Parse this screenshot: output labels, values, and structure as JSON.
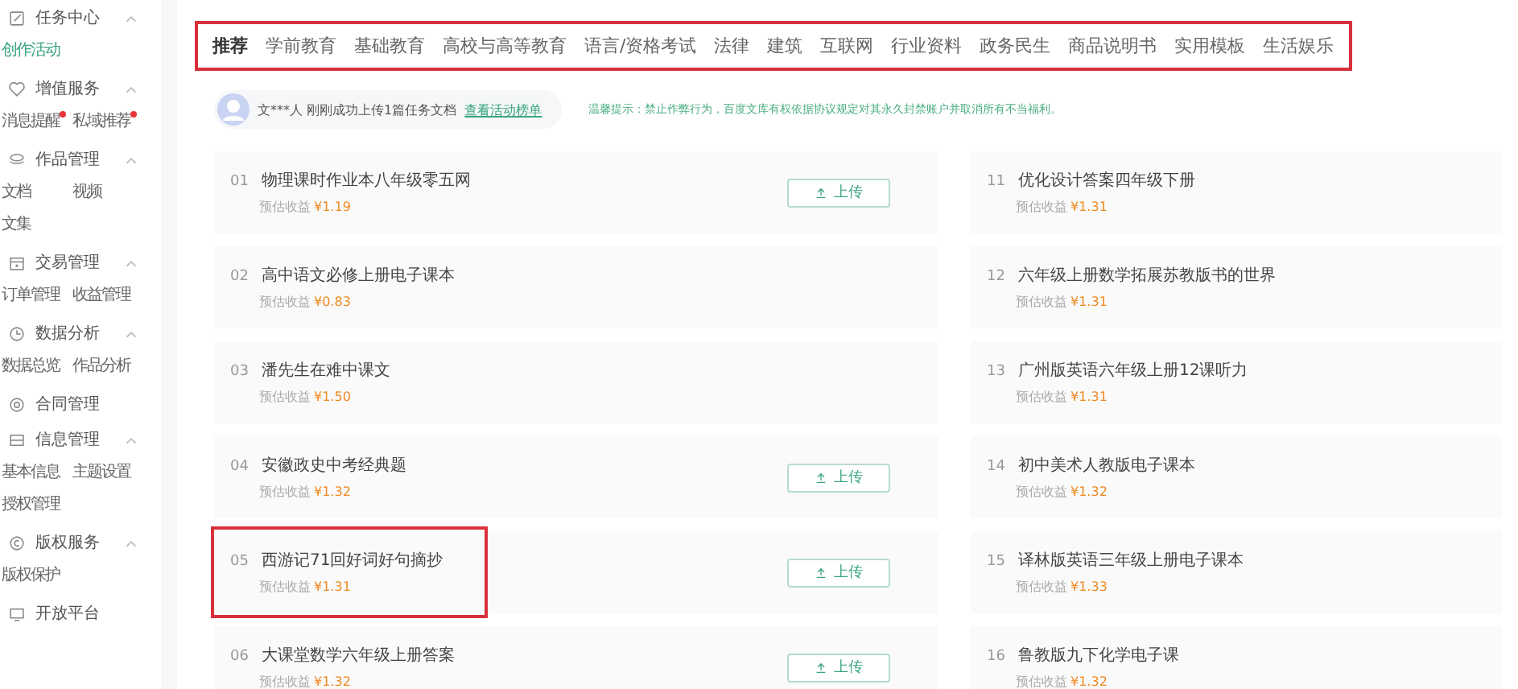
{
  "sidebar": [
    {
      "label": "任务中心",
      "expandable": true,
      "items": [
        {
          "label": "创作活动",
          "selected": true,
          "dot": false
        }
      ]
    },
    {
      "label": "增值服务",
      "expandable": true,
      "items": [
        {
          "label": "消息提醒",
          "selected": false,
          "dot": true
        },
        {
          "label": "私域推荐",
          "selected": false,
          "dot": true
        }
      ]
    },
    {
      "label": "作品管理",
      "expandable": true,
      "items": [
        {
          "label": "文档",
          "selected": false,
          "dot": false
        },
        {
          "label": "视频",
          "selected": false,
          "dot": false
        },
        {
          "label": "文集",
          "selected": false,
          "dot": false
        }
      ]
    },
    {
      "label": "交易管理",
      "expandable": true,
      "items": [
        {
          "label": "订单管理",
          "selected": false,
          "dot": false
        },
        {
          "label": "收益管理",
          "selected": false,
          "dot": false
        }
      ]
    },
    {
      "label": "数据分析",
      "expandable": true,
      "items": [
        {
          "label": "数据总览",
          "selected": false,
          "dot": false
        },
        {
          "label": "作品分析",
          "selected": false,
          "dot": false
        }
      ]
    },
    {
      "label": "合同管理",
      "expandable": false
    },
    {
      "label": "信息管理",
      "expandable": true,
      "items": [
        {
          "label": "基本信息",
          "selected": false,
          "dot": false
        },
        {
          "label": "主题设置",
          "selected": false,
          "dot": false
        },
        {
          "label": "授权管理",
          "selected": false,
          "dot": false
        }
      ]
    },
    {
      "label": "版权服务",
      "expandable": true,
      "items": [
        {
          "label": "版权保护",
          "selected": false,
          "dot": false
        }
      ]
    },
    {
      "label": "开放平台",
      "expandable": false
    }
  ],
  "tab_bar": {
    "highlighted": true,
    "tabs": [
      {
        "label": "推荐",
        "selected": true
      },
      {
        "label": "学前教育",
        "selected": false
      },
      {
        "label": "基础教育",
        "selected": false
      },
      {
        "label": "高校与高等教育",
        "selected": false
      },
      {
        "label": "语言/资格考试",
        "selected": false
      },
      {
        "label": "法律",
        "selected": false
      },
      {
        "label": "建筑",
        "selected": false
      },
      {
        "label": "互联网",
        "selected": false
      },
      {
        "label": "行业资料",
        "selected": false
      },
      {
        "label": "政务民生",
        "selected": false
      },
      {
        "label": "商品说明书",
        "selected": false
      },
      {
        "label": "实用模板",
        "selected": false
      },
      {
        "label": "生活娱乐",
        "selected": false
      }
    ]
  },
  "notice": {
    "message": "文***人 刚刚成功上传1篇任务文档",
    "link": "查看活动榜单",
    "tip": "温馨提示：禁止作弊行为，百度文库有权依据协议规定对其永久封禁账户并取消所有不当福利。"
  },
  "tasks_left": [
    {
      "number": "01",
      "title": "物理课时作业本八年级零五网",
      "earnings_label": "预估收益",
      "amount": "¥1.19",
      "button": "上传",
      "highlighted": false
    },
    {
      "number": "02",
      "title": "高中语文必修上册电子课本",
      "earnings_label": "预估收益",
      "amount": "¥0.83",
      "highlighted": false
    },
    {
      "number": "03",
      "title": "潘先生在难中课文",
      "earnings_label": "预估收益",
      "amount": "¥1.50",
      "highlighted": false
    },
    {
      "number": "04",
      "title": "安徽政史中考经典题",
      "earnings_label": "预估收益",
      "amount": "¥1.32",
      "button": "上传",
      "highlighted": false
    },
    {
      "number": "05",
      "title": "西游记71回好词好句摘抄",
      "earnings_label": "预估收益",
      "amount": "¥1.31",
      "button": "上传",
      "highlighted": true
    },
    {
      "number": "06",
      "title": "大课堂数学六年级上册答案",
      "earnings_label": "预估收益",
      "amount": "¥1.32",
      "button": "上传",
      "highlighted": false
    }
  ],
  "tasks_right": [
    {
      "number": "11",
      "title": "优化设计答案四年级下册",
      "earnings_label": "预估收益",
      "amount": "¥1.31",
      "highlighted": false
    },
    {
      "number": "12",
      "title": "六年级上册数学拓展苏教版书的世界",
      "earnings_label": "预估收益",
      "amount": "¥1.31",
      "highlighted": false
    },
    {
      "number": "13",
      "title": "广州版英语六年级上册12课听力",
      "earnings_label": "预估收益",
      "amount": "¥1.31",
      "highlighted": false
    },
    {
      "number": "14",
      "title": "初中美术人教版电子课本",
      "earnings_label": "预估收益",
      "amount": "¥1.32",
      "highlighted": false
    },
    {
      "number": "15",
      "title": "译林版英语三年级上册电子课本",
      "earnings_label": "预估收益",
      "amount": "¥1.33",
      "highlighted": false
    },
    {
      "number": "16",
      "title": "鲁教版九下化学电子课",
      "earnings_label": "预估收益",
      "amount": "¥1.32",
      "highlighted": false
    }
  ]
}
